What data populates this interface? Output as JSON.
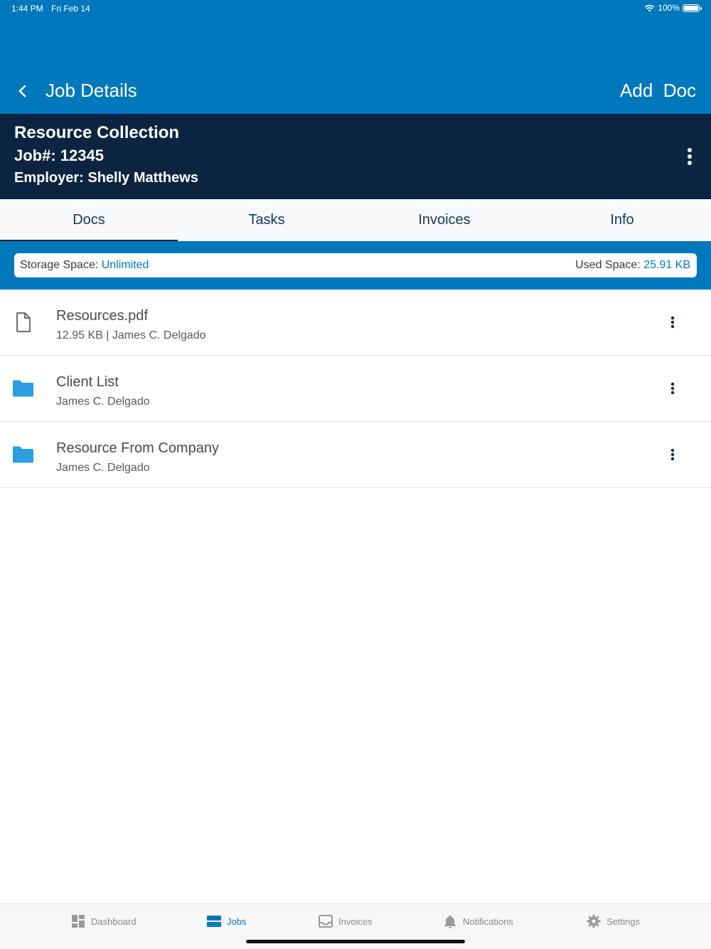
{
  "status_bar": {
    "time": "1:44 PM",
    "date": "Fri Feb 14",
    "battery": "100%",
    "battery_level": 1.0
  },
  "header": {
    "title": "Job Details",
    "action_label": "Add  Doc"
  },
  "job": {
    "title": "Resource Collection",
    "number": "Job#: 12345",
    "employer": "Employer: Shelly Matthews"
  },
  "tabs": [
    {
      "label": "Docs",
      "active": true
    },
    {
      "label": "Tasks",
      "active": false
    },
    {
      "label": "Invoices",
      "active": false
    },
    {
      "label": "Info",
      "active": false
    }
  ],
  "storage": {
    "space_label": "Storage Space:",
    "space_value": "Unlimited",
    "used_label": "Used Space:",
    "used_value": "25.91 KB"
  },
  "documents": [
    {
      "name": "Resources.pdf",
      "meta": "12.95 KB | James C. Delgado",
      "icon": "file-icon"
    },
    {
      "name": "Client List",
      "meta": "James C. Delgado",
      "icon": "folder-icon"
    },
    {
      "name": "Resource From Company",
      "meta": "James C. Delgado",
      "icon": "folder-icon"
    }
  ],
  "bottom_nav": [
    {
      "label": "Dashboard",
      "icon": "dashboard-icon",
      "active": false
    },
    {
      "label": "Jobs",
      "icon": "jobs-icon",
      "active": true
    },
    {
      "label": "Invoices",
      "icon": "inbox-icon",
      "active": false
    },
    {
      "label": "Notifications",
      "icon": "bell-icon",
      "active": false
    },
    {
      "label": "Settings",
      "icon": "gear-icon",
      "active": false
    }
  ],
  "colors": {
    "primary": "#0278bc",
    "navy": "#0a2442",
    "folder": "#2a9ee0",
    "inactive": "#8a8a8a"
  }
}
